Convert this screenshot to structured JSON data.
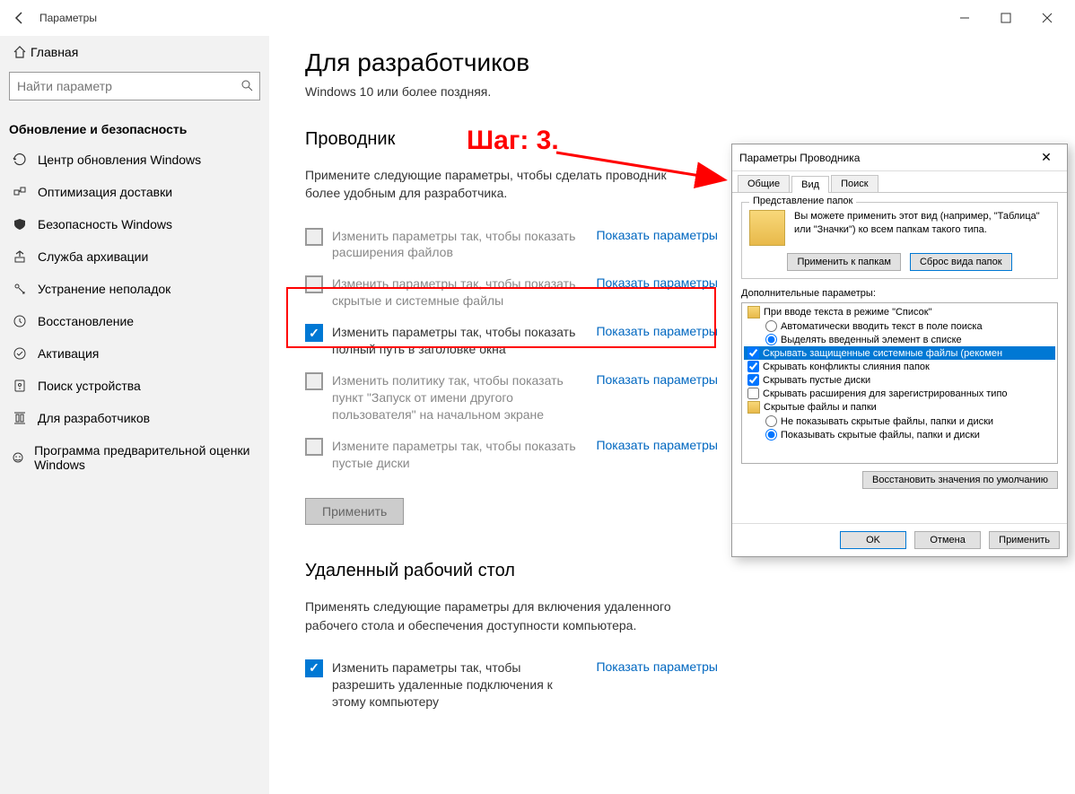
{
  "window": {
    "title": "Параметры"
  },
  "sidebar": {
    "home": "Главная",
    "search_placeholder": "Найти параметр",
    "section": "Обновление и безопасность",
    "items": [
      {
        "label": "Центр обновления Windows"
      },
      {
        "label": "Оптимизация доставки"
      },
      {
        "label": "Безопасность Windows"
      },
      {
        "label": "Служба архивации"
      },
      {
        "label": "Устранение неполадок"
      },
      {
        "label": "Восстановление"
      },
      {
        "label": "Активация"
      },
      {
        "label": "Поиск устройства"
      },
      {
        "label": "Для разработчиков"
      },
      {
        "label": "Программа предварительной оценки Windows"
      }
    ]
  },
  "page": {
    "title": "Для разработчиков",
    "subtitle": "Windows 10 или более поздняя."
  },
  "step_label": "Шаг: 3.",
  "explorer": {
    "heading": "Проводник",
    "description": "Примените следующие параметры, чтобы сделать проводник более удобным для разработчика.",
    "items": [
      {
        "text": "Изменить параметры так, чтобы показать расширения файлов",
        "link": "Показать параметры",
        "checked": false,
        "disabled": true
      },
      {
        "text": "Изменить параметры так, чтобы показать скрытые и системные файлы",
        "link": "Показать параметры",
        "checked": false,
        "disabled": true
      },
      {
        "text": "Изменить параметры так, чтобы показать полный путь в заголовке окна",
        "link": "Показать параметры",
        "checked": true,
        "disabled": false
      },
      {
        "text": "Изменить политику так, чтобы показать пункт \"Запуск от имени другого пользователя\" на начальном экране",
        "link": "Показать параметры",
        "checked": false,
        "disabled": true
      },
      {
        "text": "Измените параметры так, чтобы показать пустые диски",
        "link": "Показать параметры",
        "checked": false,
        "disabled": true
      }
    ],
    "apply": "Применить"
  },
  "remote": {
    "heading": "Удаленный рабочий стол",
    "description": "Применять следующие параметры для включения удаленного рабочего стола и обеспечения доступности компьютера.",
    "items": [
      {
        "text": "Изменить параметры так, чтобы разрешить удаленные подключения к этому компьютеру",
        "link": "Показать параметры",
        "checked": true
      }
    ]
  },
  "dialog": {
    "title": "Параметры Проводника",
    "tabs": [
      "Общие",
      "Вид",
      "Поиск"
    ],
    "active_tab": 1,
    "folder_view": {
      "legend": "Представление папок",
      "text": "Вы можете применить этот вид (например, \"Таблица\" или \"Значки\") ко всем папкам такого типа.",
      "apply": "Применить к папкам",
      "reset": "Сброс вида папок"
    },
    "advanced_label": "Дополнительные параметры:",
    "tree": [
      {
        "type": "folder",
        "indent": 0,
        "label": "При вводе текста в режиме \"Список\""
      },
      {
        "type": "radio",
        "indent": 1,
        "checked": false,
        "label": "Автоматически вводить текст в поле поиска"
      },
      {
        "type": "radio",
        "indent": 1,
        "checked": true,
        "label": "Выделять введенный элемент в списке"
      },
      {
        "type": "checkbox",
        "indent": 0,
        "checked": true,
        "selected": true,
        "label": "Скрывать защищенные системные файлы (рекомен"
      },
      {
        "type": "checkbox",
        "indent": 0,
        "checked": true,
        "label": "Скрывать конфликты слияния папок"
      },
      {
        "type": "checkbox",
        "indent": 0,
        "checked": true,
        "label": "Скрывать пустые диски"
      },
      {
        "type": "checkbox",
        "indent": 0,
        "checked": false,
        "label": "Скрывать расширения для зарегистрированных типо"
      },
      {
        "type": "folder",
        "indent": 0,
        "label": "Скрытые файлы и папки"
      },
      {
        "type": "radio",
        "indent": 1,
        "checked": false,
        "label": "Не показывать скрытые файлы, папки и диски"
      },
      {
        "type": "radio",
        "indent": 1,
        "checked": true,
        "label": "Показывать скрытые файлы, папки и диски"
      }
    ],
    "restore_defaults": "Восстановить значения по умолчанию",
    "ok": "OK",
    "cancel": "Отмена",
    "apply": "Применить"
  }
}
